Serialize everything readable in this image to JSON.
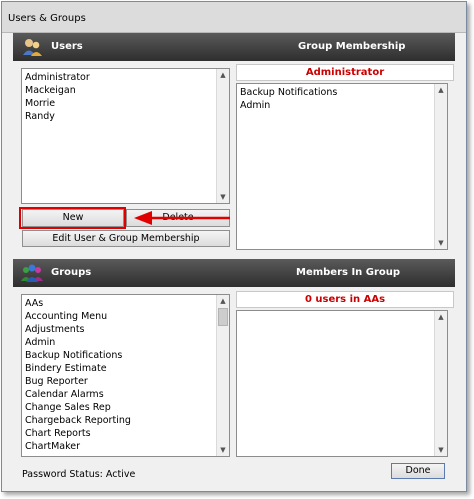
{
  "window": {
    "title": "Users & Groups"
  },
  "users_section": {
    "header_left": "Users",
    "header_right": "Group Membership",
    "users": [
      "Administrator",
      "Mackeigan",
      "Morrie",
      "Randy"
    ],
    "selected_user_caption": "Administrator",
    "memberships": [
      "Backup Notifications",
      "Admin"
    ],
    "new_label": "New",
    "delete_label": "Delete",
    "edit_label": "Edit User & Group Membership"
  },
  "groups_section": {
    "header_left": "Groups",
    "header_right": "Members In Group",
    "groups": [
      "AAs",
      "Accounting Menu",
      "Adjustments",
      "Admin",
      "Backup Notifications",
      "Bindery Estimate",
      "Bug Reporter",
      "Calendar Alarms",
      "Change Sales Rep",
      "Chargeback Reporting",
      "Chart Reports",
      "ChartMaker"
    ],
    "members_caption": "0 users in AAs"
  },
  "footer": {
    "password_status_label": "Password Status:",
    "password_status_value": "Active",
    "done_label": "Done"
  },
  "colors": {
    "annotation": "#e00000",
    "caption_text": "#cc0000",
    "header_bg": "#3a3a3a"
  },
  "icons": {
    "users_header": "users-icon",
    "groups_header": "groups-icon",
    "annotation": "arrow-left-icon"
  }
}
